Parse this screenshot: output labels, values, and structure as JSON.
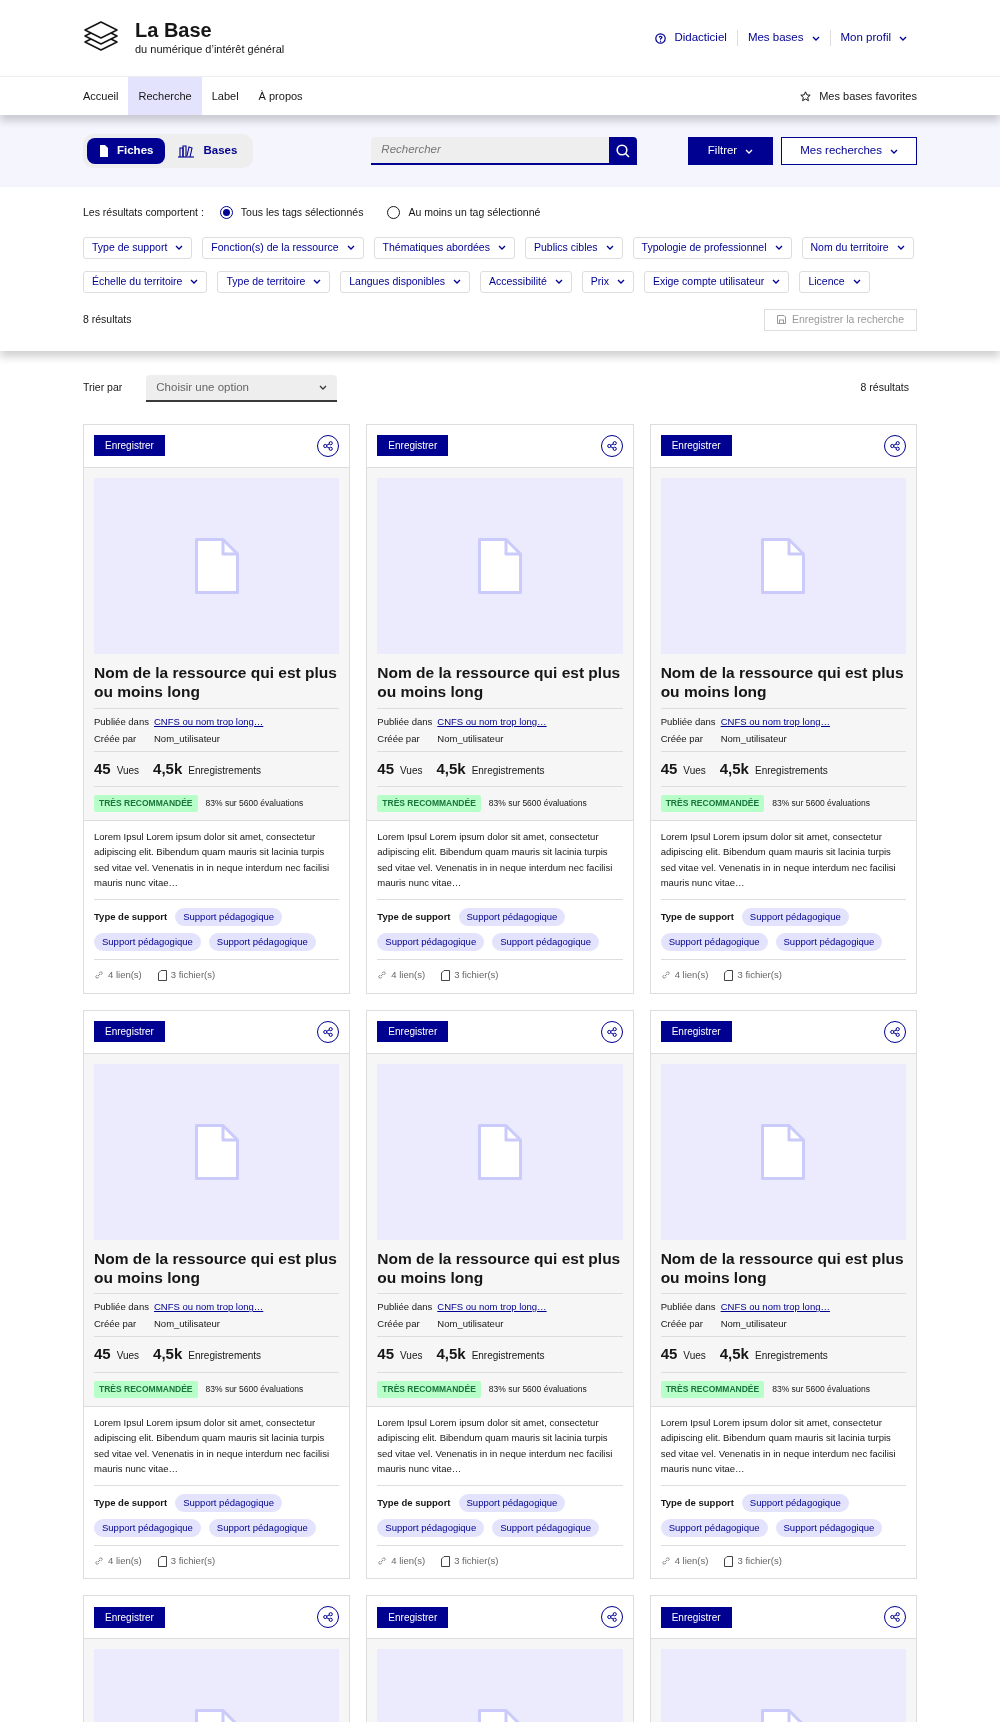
{
  "header": {
    "title": "La Base",
    "subtitle": "du numérique d’intérêt général",
    "links": [
      {
        "label": "Didacticiel",
        "kind": "help"
      },
      {
        "label": "Mes bases",
        "kind": "dropdown"
      },
      {
        "label": "Mon profil",
        "kind": "dropdown"
      }
    ]
  },
  "nav": {
    "items": [
      {
        "label": "Accueil",
        "selected": false
      },
      {
        "label": "Recherche",
        "selected": true
      },
      {
        "label": "Label",
        "selected": false
      },
      {
        "label": "À propos",
        "selected": false
      }
    ],
    "favorites": "Mes bases favorites"
  },
  "search_bar": {
    "toggle": [
      {
        "label": "Fiches",
        "kind": "file",
        "selected": true
      },
      {
        "label": "Bases",
        "kind": "books",
        "selected": false
      }
    ],
    "search": {
      "placeholder": "Rechercher"
    },
    "filter_button": "Filtrer",
    "saved_searches_button": "Mes recherches"
  },
  "filters": {
    "mode_label": "Les résultats comportent :",
    "modes": [
      {
        "label": "Tous les tags sélectionnés",
        "selected": true
      },
      {
        "label": "Au moins un tag sélectionné",
        "selected": false
      }
    ],
    "tags": [
      "Type de support",
      "Fonction(s) de la ressource",
      "Thématiques abordées",
      "Publics cibles",
      "Typologie de professionnel",
      "Nom du territoire",
      "Échelle du territoire",
      "Type de territoire",
      "Langues disponibles",
      "Accessibilité",
      "Prix",
      "Exige compte utilisateur",
      "Licence"
    ],
    "result_count": "8 résultats",
    "save_search": {
      "label": "Enregistrer la recherche",
      "disabled": true
    }
  },
  "sort": {
    "label": "Trier par",
    "value": "Choisir une option",
    "result_count": "8 résultats"
  },
  "cards": [
    {
      "save_label": "Enregistrer",
      "title": "Nom de la ressource qui est plus ou moins long",
      "published_label": "Publiée dans",
      "published_in": "CNFS ou nom trop long…",
      "created_label": "Créée par",
      "creator": "Nom_utilisateur",
      "views": "45",
      "views_label": "Vues",
      "saves": "4,5k",
      "saves_label": "Enregistrements",
      "badge": "TRÈS RECOMMANDÉE",
      "rating": "83% sur 5600 évaluations",
      "description": "Lorem Ipsul Lorem ipsum dolor sit amet, consectetur adipiscing elit. Bibendum quam mauris sit lacinia turpis sed vitae vel. Venenatis in in neque interdum nec facilisi mauris nunc vitae…",
      "tag_label": "Type de support",
      "tags": [
        "Support pédagogique",
        "Support pédagogique",
        "Support pédagogique"
      ],
      "links": "4 lien(s)",
      "files": "3 fichier(s)"
    },
    {
      "save_label": "Enregistrer",
      "title": "Nom de la ressource qui est plus ou moins long",
      "published_label": "Publiée dans",
      "published_in": "CNFS ou nom trop long…",
      "created_label": "Créée par",
      "creator": "Nom_utilisateur",
      "views": "45",
      "views_label": "Vues",
      "saves": "4,5k",
      "saves_label": "Enregistrements",
      "badge": "TRÈS RECOMMANDÉE",
      "rating": "83% sur 5600 évaluations",
      "description": "Lorem Ipsul Lorem ipsum dolor sit amet, consectetur adipiscing elit. Bibendum quam mauris sit lacinia turpis sed vitae vel. Venenatis in in neque interdum nec facilisi mauris nunc vitae…",
      "tag_label": "Type de support",
      "tags": [
        "Support pédagogique",
        "Support pédagogique",
        "Support pédagogique"
      ],
      "links": "4 lien(s)",
      "files": "3 fichier(s)"
    },
    {
      "save_label": "Enregistrer",
      "title": "Nom de la ressource qui est plus ou moins long",
      "published_label": "Publiée dans",
      "published_in": "CNFS ou nom trop long…",
      "created_label": "Créée par",
      "creator": "Nom_utilisateur",
      "views": "45",
      "views_label": "Vues",
      "saves": "4,5k",
      "saves_label": "Enregistrements",
      "badge": "TRÈS RECOMMANDÉE",
      "rating": "83% sur 5600 évaluations",
      "description": "Lorem Ipsul Lorem ipsum dolor sit amet, consectetur adipiscing elit. Bibendum quam mauris sit lacinia turpis sed vitae vel. Venenatis in in neque interdum nec facilisi mauris nunc vitae…",
      "tag_label": "Type de support",
      "tags": [
        "Support pédagogique",
        "Support pédagogique",
        "Support pédagogique"
      ],
      "links": "4 lien(s)",
      "files": "3 fichier(s)"
    },
    {
      "save_label": "Enregistrer",
      "title": "Nom de la ressource qui est plus ou moins long",
      "published_label": "Publiée dans",
      "published_in": "CNFS ou nom trop long…",
      "created_label": "Créée par",
      "creator": "Nom_utilisateur",
      "views": "45",
      "views_label": "Vues",
      "saves": "4,5k",
      "saves_label": "Enregistrements",
      "badge": "TRÈS RECOMMANDÉE",
      "rating": "83% sur 5600 évaluations",
      "description": "Lorem Ipsul Lorem ipsum dolor sit amet, consectetur adipiscing elit. Bibendum quam mauris sit lacinia turpis sed vitae vel. Venenatis in in neque interdum nec facilisi mauris nunc vitae…",
      "tag_label": "Type de support",
      "tags": [
        "Support pédagogique",
        "Support pédagogique",
        "Support pédagogique"
      ],
      "links": "4 lien(s)",
      "files": "3 fichier(s)"
    },
    {
      "save_label": "Enregistrer",
      "title": "Nom de la ressource qui est plus ou moins long",
      "published_label": "Publiée dans",
      "published_in": "CNFS ou nom trop long…",
      "created_label": "Créée par",
      "creator": "Nom_utilisateur",
      "views": "45",
      "views_label": "Vues",
      "saves": "4,5k",
      "saves_label": "Enregistrements",
      "badge": "TRÈS RECOMMANDÉE",
      "rating": "83% sur 5600 évaluations",
      "description": "Lorem Ipsul Lorem ipsum dolor sit amet, consectetur adipiscing elit. Bibendum quam mauris sit lacinia turpis sed vitae vel. Venenatis in in neque interdum nec facilisi mauris nunc vitae…",
      "tag_label": "Type de support",
      "tags": [
        "Support pédagogique",
        "Support pédagogique",
        "Support pédagogique"
      ],
      "links": "4 lien(s)",
      "files": "3 fichier(s)"
    },
    {
      "save_label": "Enregistrer",
      "title": "Nom de la ressource qui est plus ou moins long",
      "published_label": "Publiée dans",
      "published_in": "CNFS ou nom trop long…",
      "created_label": "Créée par",
      "creator": "Nom_utilisateur",
      "views": "45",
      "views_label": "Vues",
      "saves": "4,5k",
      "saves_label": "Enregistrements",
      "badge": "TRÈS RECOMMANDÉE",
      "rating": "83% sur 5600 évaluations",
      "description": "Lorem Ipsul Lorem ipsum dolor sit amet, consectetur adipiscing elit. Bibendum quam mauris sit lacinia turpis sed vitae vel. Venenatis in in neque interdum nec facilisi mauris nunc vitae…",
      "tag_label": "Type de support",
      "tags": [
        "Support pédagogique",
        "Support pédagogique",
        "Support pédagogique"
      ],
      "links": "4 lien(s)",
      "files": "3 fichier(s)"
    },
    {
      "save_label": "Enregistrer"
    },
    {
      "save_label": "Enregistrer"
    },
    {
      "save_label": "Enregistrer"
    }
  ]
}
